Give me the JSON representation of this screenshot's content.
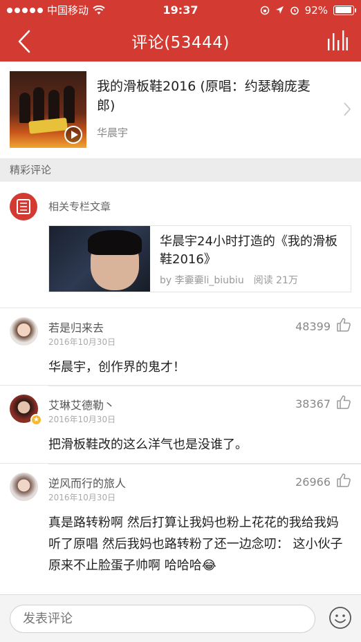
{
  "status_bar": {
    "carrier": "中国移动",
    "time": "19:37",
    "battery": "92%",
    "battery_level": 0.92
  },
  "nav": {
    "title": "评论(53444)",
    "back_icon": "chevron-left-icon",
    "right_icon": "bar-chart-icon"
  },
  "song": {
    "title": "我的滑板鞋2016 (原唱：约瑟翰庞麦郎)",
    "artist": "华晨宇"
  },
  "section": {
    "label": "精彩评论"
  },
  "related": {
    "label": "相关专栏文章",
    "article": {
      "title": "华晨宇24小时打造的《我的滑板鞋2016》",
      "author": "by 李嫑嫑li_biubiu",
      "reads": "阅读 21万"
    }
  },
  "comments": [
    {
      "user": "若是归来去",
      "date": "2016年10月30日",
      "likes": "48399",
      "text": "华晨宇，创作界的鬼才！"
    },
    {
      "user": "艾琳艾德勒丶",
      "date": "2016年10月30日",
      "likes": "38367",
      "text": "把滑板鞋改的这么洋气也是没谁了。"
    },
    {
      "user": "逆风而行的旅人",
      "date": "2016年10月30日",
      "likes": "26966",
      "text": "真是路转粉啊 然后打算让我妈也粉上花花的我给我妈听了原唱 然后我妈也路转粉了还一边念叨： 这小伙子原来不止脸蛋子帅啊 哈哈哈😂"
    }
  ],
  "input": {
    "placeholder": "发表评论"
  },
  "colors": {
    "brand_red": "#d33a31"
  }
}
